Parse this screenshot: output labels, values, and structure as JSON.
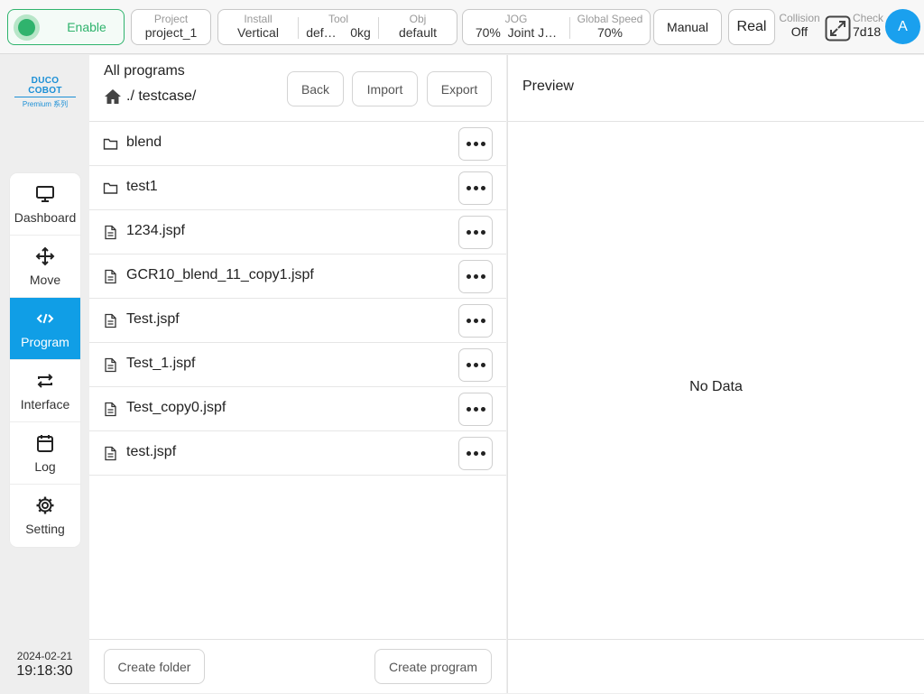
{
  "topbar": {
    "enable_label": "Enable",
    "project": {
      "label": "Project",
      "value": "project_1"
    },
    "install": {
      "label": "Install",
      "value": "Vertical"
    },
    "tool": {
      "label": "Tool",
      "name": "def…",
      "load": "0kg"
    },
    "obj": {
      "label": "Obj",
      "value": "default"
    },
    "jog": {
      "label": "JOG",
      "speed": "70%",
      "mode": "Joint J…"
    },
    "global_speed": {
      "label": "Global Speed",
      "value": "70%"
    },
    "mode_label": "Manual",
    "real_label": "Real",
    "collision": {
      "label": "Collision",
      "value": "Off"
    },
    "check": {
      "label": "Check",
      "value": "7d18"
    },
    "avatar_letter": "A"
  },
  "sidebar": {
    "logo": {
      "brand": "DUCO COBOT",
      "sub": "Premium 系列"
    },
    "items": [
      {
        "label": "Dashboard",
        "icon": "monitor-icon"
      },
      {
        "label": "Move",
        "icon": "move-arrows-icon"
      },
      {
        "label": "Program",
        "icon": "code-icon",
        "active": true
      },
      {
        "label": "Interface",
        "icon": "swap-arrows-icon"
      },
      {
        "label": "Log",
        "icon": "calendar-icon"
      },
      {
        "label": "Setting",
        "icon": "gear-icon"
      }
    ],
    "date": "2024-02-21",
    "time": "19:18:30"
  },
  "programs": {
    "title": "All programs",
    "path": "./ testcase/",
    "back_label": "Back",
    "import_label": "Import",
    "export_label": "Export",
    "items": [
      {
        "name": "blend",
        "type": "folder"
      },
      {
        "name": "test1",
        "type": "folder"
      },
      {
        "name": "1234.jspf",
        "type": "file"
      },
      {
        "name": "GCR10_blend_11_copy1.jspf",
        "type": "file"
      },
      {
        "name": "Test.jspf",
        "type": "file"
      },
      {
        "name": "Test_1.jspf",
        "type": "file"
      },
      {
        "name": "Test_copy0.jspf",
        "type": "file"
      },
      {
        "name": "test.jspf",
        "type": "file"
      }
    ],
    "create_folder_label": "Create folder",
    "create_program_label": "Create program"
  },
  "preview": {
    "title": "Preview",
    "empty_text": "No Data"
  },
  "colors": {
    "accent": "#109ee6",
    "enable_green": "#2fb36d",
    "avatar_blue": "#1aa0ee"
  }
}
